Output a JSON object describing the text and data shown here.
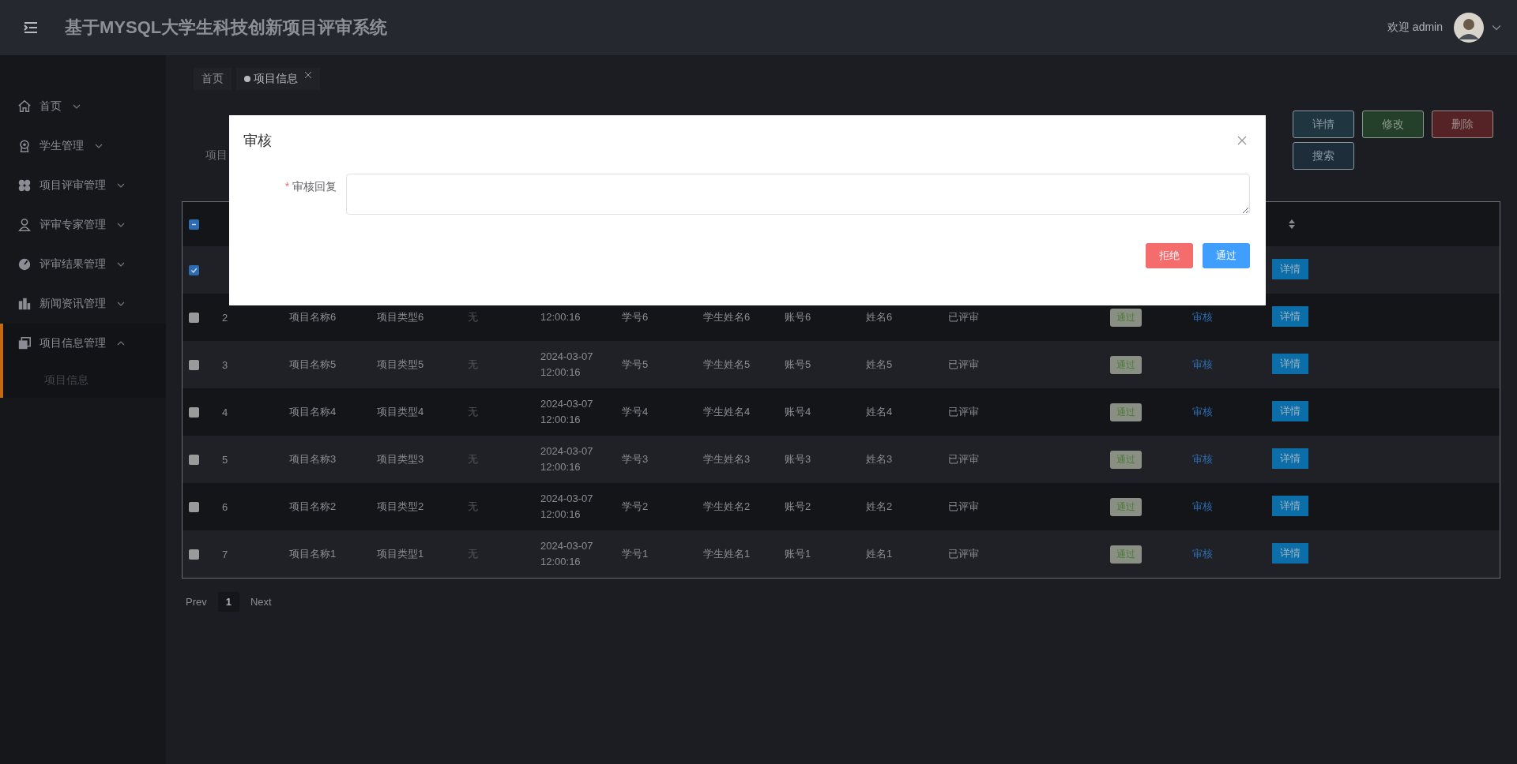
{
  "header": {
    "title": "基于MYSQL大学生科技创新项目评审系统",
    "welcome": "欢迎 admin"
  },
  "sidebar": {
    "items": [
      {
        "label": "首页",
        "expanded": false,
        "selected": false
      },
      {
        "label": "学生管理",
        "expanded": false,
        "selected": false
      },
      {
        "label": "项目评审管理",
        "expanded": false,
        "selected": false
      },
      {
        "label": "评审专家管理",
        "expanded": false,
        "selected": false
      },
      {
        "label": "评审结果管理",
        "expanded": false,
        "selected": false
      },
      {
        "label": "新闻资讯管理",
        "expanded": false,
        "selected": false
      },
      {
        "label": "项目信息管理",
        "expanded": true,
        "selected": true,
        "children": [
          {
            "label": "项目信息",
            "selected": false
          }
        ]
      }
    ]
  },
  "tabs": [
    {
      "label": "首页",
      "selected": false,
      "closable": false
    },
    {
      "label": "项目信息",
      "selected": true,
      "closable": true
    }
  ],
  "toolbar": {
    "search_label": "项目",
    "buttons": [
      {
        "label": "详情",
        "kind": "info"
      },
      {
        "label": "修改",
        "kind": "edit"
      },
      {
        "label": "删除",
        "kind": "delete"
      },
      {
        "label": "搜索",
        "kind": "search"
      }
    ]
  },
  "table": {
    "select_all_indeterminate": true,
    "rows": [
      {
        "selected": true,
        "action": "详情"
      },
      {
        "selected": false,
        "index": "2",
        "name": "项目名称6",
        "type": "项目类型6",
        "note": "无",
        "time": "12:00:16",
        "student_no": "学号6",
        "student_name": "学生姓名6",
        "account": "账号6",
        "reviewer": "姓名6",
        "status": "已评审",
        "result": "通过",
        "review": "审核",
        "action": "详情"
      },
      {
        "selected": false,
        "index": "3",
        "name": "项目名称5",
        "type": "项目类型5",
        "note": "无",
        "date": "2024-03-07",
        "time": "12:00:16",
        "student_no": "学号5",
        "student_name": "学生姓名5",
        "account": "账号5",
        "reviewer": "姓名5",
        "status": "已评审",
        "result": "通过",
        "review": "审核",
        "action": "详情"
      },
      {
        "selected": false,
        "index": "4",
        "name": "项目名称4",
        "type": "项目类型4",
        "note": "无",
        "date": "2024-03-07",
        "time": "12:00:16",
        "student_no": "学号4",
        "student_name": "学生姓名4",
        "account": "账号4",
        "reviewer": "姓名4",
        "status": "已评审",
        "result": "通过",
        "review": "审核",
        "action": "详情"
      },
      {
        "selected": false,
        "index": "5",
        "name": "项目名称3",
        "type": "项目类型3",
        "note": "无",
        "date": "2024-03-07",
        "time": "12:00:16",
        "student_no": "学号3",
        "student_name": "学生姓名3",
        "account": "账号3",
        "reviewer": "姓名3",
        "status": "已评审",
        "result": "通过",
        "review": "审核",
        "action": "详情"
      },
      {
        "selected": false,
        "index": "6",
        "name": "项目名称2",
        "type": "项目类型2",
        "note": "无",
        "date": "2024-03-07",
        "time": "12:00:16",
        "student_no": "学号2",
        "student_name": "学生姓名2",
        "account": "账号2",
        "reviewer": "姓名2",
        "status": "已评审",
        "result": "通过",
        "review": "审核",
        "action": "详情"
      },
      {
        "selected": false,
        "index": "7",
        "name": "项目名称1",
        "type": "项目类型1",
        "note": "无",
        "date": "2024-03-07",
        "time": "12:00:16",
        "student_no": "学号1",
        "student_name": "学生姓名1",
        "account": "账号1",
        "reviewer": "姓名1",
        "status": "已评审",
        "result": "通过",
        "review": "审核",
        "action": "详情"
      }
    ]
  },
  "pagination": {
    "prev": "Prev",
    "pages": [
      {
        "label": "1",
        "selected": true
      }
    ],
    "next": "Next"
  },
  "modal": {
    "title": "审核",
    "field": {
      "label": "审核回复",
      "required_mark": "*"
    },
    "buttons": [
      {
        "label": "拒绝",
        "kind": "reject"
      },
      {
        "label": "通过",
        "kind": "approve"
      }
    ]
  }
}
